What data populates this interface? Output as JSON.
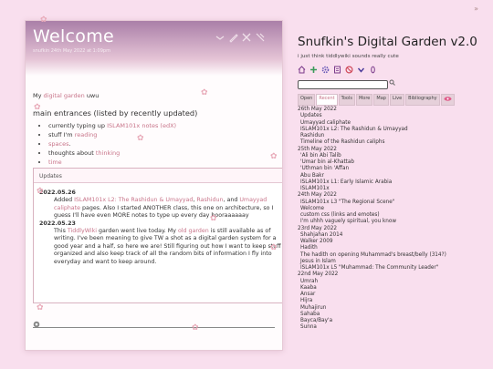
{
  "story": {
    "title": "Welcome",
    "subtitle": "snufkin 24th May 2022 at 1:09pm",
    "intro_prefix": "My",
    "intro_link": "digital garden",
    "intro_suffix": "uwu",
    "entrances_heading": "main entrances (listed by recently updated)",
    "entrances": [
      {
        "text_before": "currently typing up",
        "link": "ISLAM101x notes (edX)",
        "text_after": ""
      },
      {
        "text_before": "stuff I'm",
        "link": "reading",
        "text_after": ""
      },
      {
        "text_before": "",
        "link": "spaces",
        "text_after": "."
      },
      {
        "text_before": "thoughts about",
        "link": "thinking",
        "text_after": ""
      },
      {
        "text_before": "",
        "link": "time",
        "text_after": ""
      }
    ],
    "updates_title": "Updates",
    "updates": [
      {
        "date": "2022.05.26",
        "parts": [
          {
            "t": "Added ",
            "link": false
          },
          {
            "t": "ISLAM101x L2: The Rashidun & Umayyad",
            "link": true
          },
          {
            "t": ", ",
            "link": false
          },
          {
            "t": "Rashidun",
            "link": true
          },
          {
            "t": ", and ",
            "link": false
          },
          {
            "t": "Umayyad caliphate",
            "link": true
          },
          {
            "t": " pages. Also I started ANOTHER class, this one on architecture, so I guess I'll have even MORE notes to type up every day hooraaaaaay",
            "link": false
          }
        ]
      },
      {
        "date": "2022.05.23",
        "parts": [
          {
            "t": "This ",
            "link": false
          },
          {
            "t": "TiddlyWiki",
            "link": true
          },
          {
            "t": " garden went live today. My ",
            "link": false
          },
          {
            "t": "old garden",
            "link": true
          },
          {
            "t": " is still available as of writing. I've been meaning to give TW a shot as a digital garden system for a good year and a half, so here we are! Still figuring out how I want to keep stuff organized and also keep track of all the random bits of information I fly into everyday and want to keep around.",
            "link": false
          }
        ]
      }
    ]
  },
  "sidebar": {
    "title": "Snufkin's Digital Garden v2.0",
    "subtitle": "i just think tiddlywiki sounds really cute",
    "toolbar_icons": [
      "home-icon",
      "plus-icon",
      "gear-icon",
      "new-journal-icon",
      "stop-icon",
      "chevron-icon",
      "info-icon"
    ],
    "tabs": [
      "Open",
      "Recent",
      "Tools",
      "More",
      "Map",
      "Live",
      "Bibliography",
      "eye-icon"
    ],
    "active_tab": "Recent",
    "recent": [
      {
        "type": "date",
        "text": "26th May 2022"
      },
      {
        "type": "entry",
        "text": "Updates"
      },
      {
        "type": "entry",
        "text": "Umayyad caliphate"
      },
      {
        "type": "entry",
        "text": "ISLAM101x L2: The Rashidun & Umayyad"
      },
      {
        "type": "entry",
        "text": "Rashidun"
      },
      {
        "type": "entry",
        "text": "Timeline of the Rashidun caliphs"
      },
      {
        "type": "date",
        "text": "25th May 2022"
      },
      {
        "type": "entry",
        "text": "'Ali bin Abi Talib"
      },
      {
        "type": "entry",
        "text": "'Umar bin al-Khattab"
      },
      {
        "type": "entry",
        "text": "'Uthman bin 'Affan"
      },
      {
        "type": "entry",
        "text": "Abu Bakr"
      },
      {
        "type": "entry",
        "text": "ISLAM101x L1: Early Islamic Arabia"
      },
      {
        "type": "entry",
        "text": "ISLAM101x"
      },
      {
        "type": "date",
        "text": "24th May 2022"
      },
      {
        "type": "entry",
        "text": "ISLAM101x L3 \"The Regional Scene\""
      },
      {
        "type": "entry",
        "text": "Welcome"
      },
      {
        "type": "entry",
        "text": "custom css (links and emotes)"
      },
      {
        "type": "entry",
        "text": "I'm uhhh vaguely spiritual, you know"
      },
      {
        "type": "date",
        "text": "23rd May 2022"
      },
      {
        "type": "entry",
        "text": "Shahjahan 2014"
      },
      {
        "type": "entry",
        "text": "Walker 2009"
      },
      {
        "type": "entry",
        "text": "Hadith"
      },
      {
        "type": "entry",
        "text": "The hadith on opening Muhammad's breast/belly (314?)"
      },
      {
        "type": "entry",
        "text": "Jesus in Islam"
      },
      {
        "type": "entry",
        "text": "ISLAM101x L5 \"Muhammad: The Community Leader\""
      },
      {
        "type": "date",
        "text": "22nd May 2022"
      },
      {
        "type": "entry",
        "text": "Umrah"
      },
      {
        "type": "entry",
        "text": "Kaaba"
      },
      {
        "type": "entry",
        "text": "Ansar"
      },
      {
        "type": "entry",
        "text": "Hijra"
      },
      {
        "type": "entry",
        "text": "Muhajirun"
      },
      {
        "type": "entry",
        "text": "Sahaba"
      },
      {
        "type": "entry",
        "text": "Bayca/Bay'a"
      },
      {
        "type": "entry",
        "text": "Sunna"
      }
    ]
  },
  "colors": {
    "background": "#f9dfee",
    "link": "#c8758a",
    "header_gradient_top": "#aa7fa8"
  }
}
